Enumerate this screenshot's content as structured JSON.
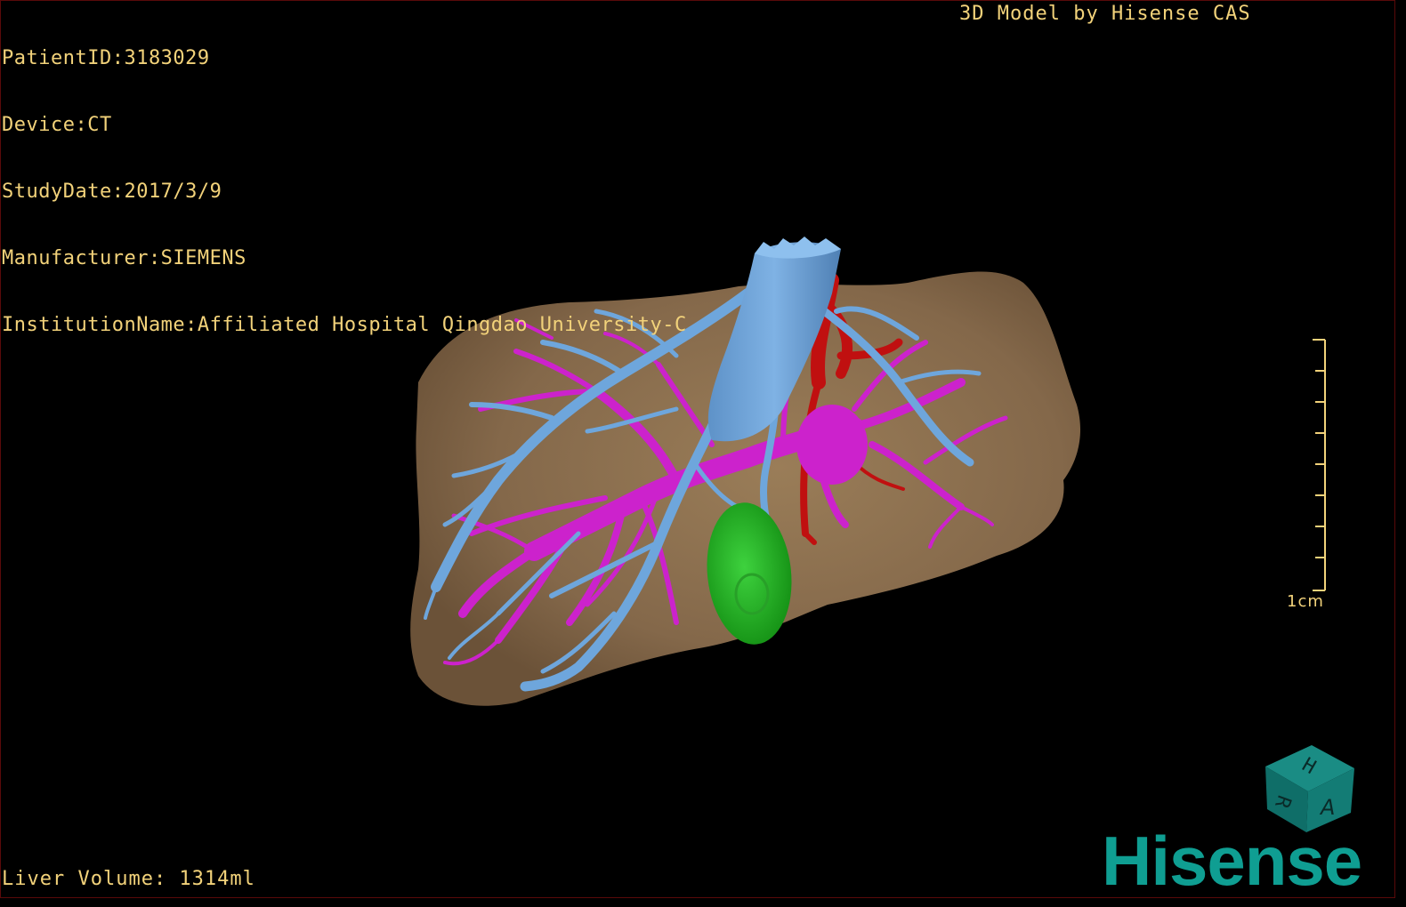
{
  "study_info": {
    "patient_id": "PatientID:3183029",
    "device": "Device:CT",
    "study_date": "StudyDate:2017/3/9",
    "manufacturer": "Manufacturer:SIEMENS",
    "institution": "InstitutionName:Affiliated Hospital Qingdao University-C"
  },
  "credit": "3D Model by Hisense CAS",
  "liver_volume": "Liver Volume: 1314ml",
  "scale_bar": {
    "label": "1cm"
  },
  "orientation_cube": {
    "letters": [
      "H",
      "R",
      "A"
    ],
    "icon": "orientation-cube-icon"
  },
  "brand": "Hisense",
  "colors": {
    "background": "#000000",
    "text": "#f2d27a",
    "liver": "#8b6f4e",
    "hepatic_vein": "#6ea6dc",
    "portal_vein": "#cc22cc",
    "artery": "#c01010",
    "gallbladder": "#22b022",
    "brand": "#0f9e92"
  }
}
